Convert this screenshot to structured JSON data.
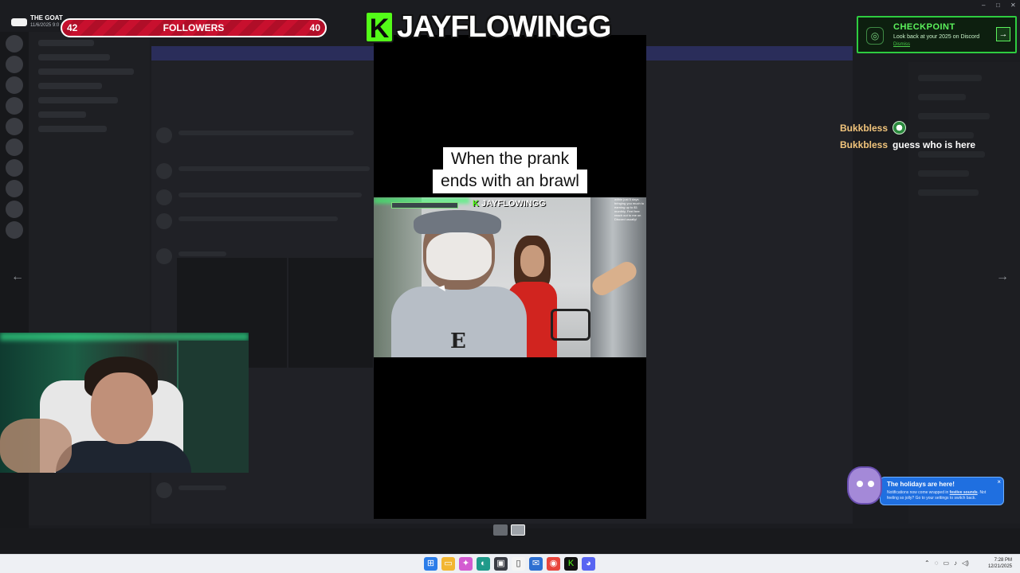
{
  "stream": {
    "channel_name": "THE GOAT",
    "channel_date": "11/6/2025 9:0",
    "followers": {
      "current": "42",
      "label": "FOLLOWERS",
      "goal": "40"
    },
    "brand": {
      "k": "K",
      "name": "JAYFLOWINGG"
    }
  },
  "checkpoint": {
    "title": "CHECKPOINT",
    "subtitle": "Look back at your 2025 on Discord",
    "link": "Dismiss",
    "arrow": "→"
  },
  "chat": [
    {
      "user": "Bukkbless",
      "text": "",
      "emote": "soccer-ball-emote"
    },
    {
      "user": "Bukkbless",
      "text": "guess who is here",
      "emote": ""
    }
  ],
  "video": {
    "caption_line1": "When the prank",
    "caption_line2": "ends with an brawl",
    "inner_brand": "JAYFLOWINGG",
    "inner_brand_k": "K",
    "side_note": "within just 5 days bringing you much to earning up to $1 monthly. Feel free reach out to me on Discord usually!"
  },
  "nav": {
    "prev": "←",
    "next": "→"
  },
  "toast": {
    "title": "The holidays are here!",
    "body_pre": "Notifications now come wrapped in ",
    "body_em": "festive sounds",
    "body_post": ". Not feeling so jolly? Go to your settings to switch back.",
    "close": "×"
  },
  "taskbar": {
    "time": "7:28 PM",
    "date": "12/21/2025",
    "apps": [
      "windows-start-icon",
      "file-explorer-icon",
      "copilot-icon",
      "edge-icon",
      "store-icon",
      "notepad-icon",
      "mail-icon",
      "chrome-icon",
      "kick-icon",
      "discord-icon"
    ]
  },
  "colors": {
    "kick_green": "#53fc18",
    "followers_red": "#c8102e",
    "checkpoint_green": "#2ecc40",
    "chat_user": "#f2c57c",
    "toast_blue": "#1f6fe0"
  }
}
